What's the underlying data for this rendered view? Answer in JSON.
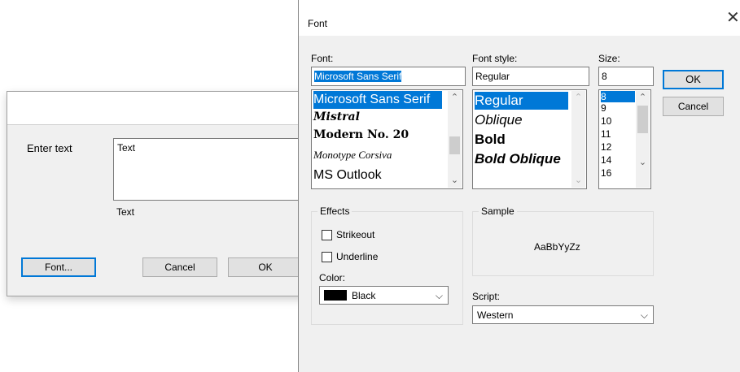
{
  "bg_dialog": {
    "label": "Enter text",
    "text_value": "Text",
    "preview": "Text",
    "font_button": "Font...",
    "cancel_button": "Cancel",
    "ok_button": "OK"
  },
  "font_dialog": {
    "title": "Font",
    "close_icon": "close-icon",
    "font_label": "Font:",
    "font_value": "Microsoft Sans Serif",
    "font_list": [
      "Microsoft Sans Serif",
      "Mistral",
      "Modern No. 20",
      "Monotype Corsiva",
      "MS Outlook"
    ],
    "style_label": "Font style:",
    "style_value": "Regular",
    "style_list": [
      "Regular",
      "Oblique",
      "Bold",
      "Bold Oblique"
    ],
    "size_label": "Size:",
    "size_value": "8",
    "size_list": [
      "8",
      "9",
      "10",
      "11",
      "12",
      "14",
      "16"
    ],
    "ok_button": "OK",
    "cancel_button": "Cancel",
    "effects_label": "Effects",
    "strikeout_label": "Strikeout",
    "underline_label": "Underline",
    "color_label": "Color:",
    "color_value": "Black",
    "color_swatch": "#000000",
    "sample_label": "Sample",
    "sample_text": "AaBbYyZz",
    "script_label": "Script:",
    "script_value": "Western"
  },
  "colors": {
    "selection": "#0078d7",
    "dialog_bg": "#f0f0f0"
  }
}
